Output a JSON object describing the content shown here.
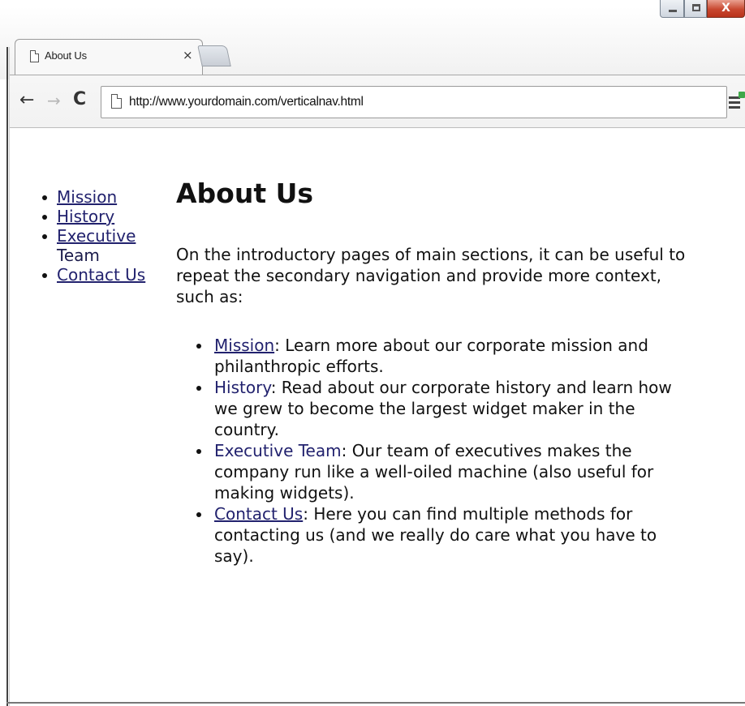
{
  "browser": {
    "tab_title": "About Us",
    "tab_close": "×",
    "url": "http://www.yourdomain.com/verticalnav.html",
    "window_close_glyph": "X",
    "accent_close": "#c8472f"
  },
  "sidebar": {
    "items": [
      {
        "label": "Mission"
      },
      {
        "label": "History"
      },
      {
        "label_line1": "Executive",
        "label_line2": "Team"
      },
      {
        "label": "Contact Us"
      }
    ]
  },
  "main": {
    "heading": "About Us",
    "intro": "On the introductory pages of main sections, it can be useful to repeat the secondary navigation and provide more context, such as:",
    "items": [
      {
        "link": "Mission",
        "text": ": Learn more about our corporate mission and philanthropic efforts."
      },
      {
        "link": "History",
        "text": ": Read about our corporate history and learn how we grew to become the largest widget maker in the country."
      },
      {
        "link": "Executive Team",
        "text": ": Our team of executives makes the company run like a well-oiled machine (also useful for making widgets)."
      },
      {
        "link": "Contact Us",
        "text": ": Here you can find multiple methods for contacting us (and we really do care what you have to say)."
      }
    ]
  }
}
